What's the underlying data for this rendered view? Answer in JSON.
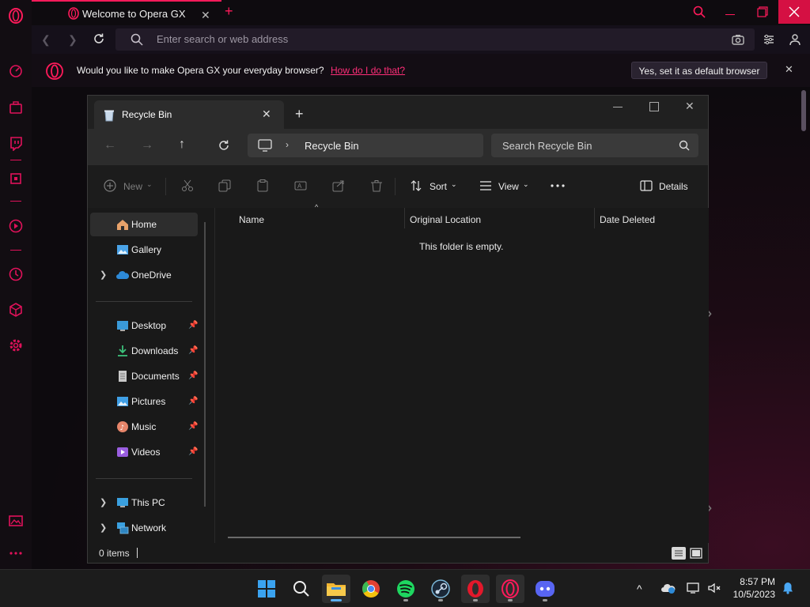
{
  "browser": {
    "tab_title": "Welcome to Opera GX",
    "search_placeholder": "Enter search or web address",
    "banner_message": "Would you like to make Opera GX your everyday browser?",
    "banner_link": "How do I do that?",
    "banner_button": "Yes, set it as default browser",
    "accent_color": "#ff1a5a"
  },
  "explorer": {
    "tab_title": "Recycle Bin",
    "breadcrumb": "Recycle Bin",
    "search_placeholder": "Search Recycle Bin",
    "commands": {
      "new": "New",
      "sort": "Sort",
      "view": "View",
      "details": "Details"
    },
    "nav": {
      "home": "Home",
      "gallery": "Gallery",
      "onedrive": "OneDrive",
      "desktop": "Desktop",
      "downloads": "Downloads",
      "documents": "Documents",
      "pictures": "Pictures",
      "music": "Music",
      "videos": "Videos",
      "this_pc": "This PC",
      "network": "Network"
    },
    "columns": [
      "Name",
      "Original Location",
      "Date Deleted"
    ],
    "empty_message": "This folder is empty.",
    "status": "0 items"
  },
  "taskbar": {
    "time": "8:57 PM",
    "date": "10/5/2023",
    "apps": [
      "start",
      "search",
      "file-explorer",
      "chrome",
      "spotify",
      "steam",
      "opera",
      "opera-gx",
      "discord"
    ]
  }
}
